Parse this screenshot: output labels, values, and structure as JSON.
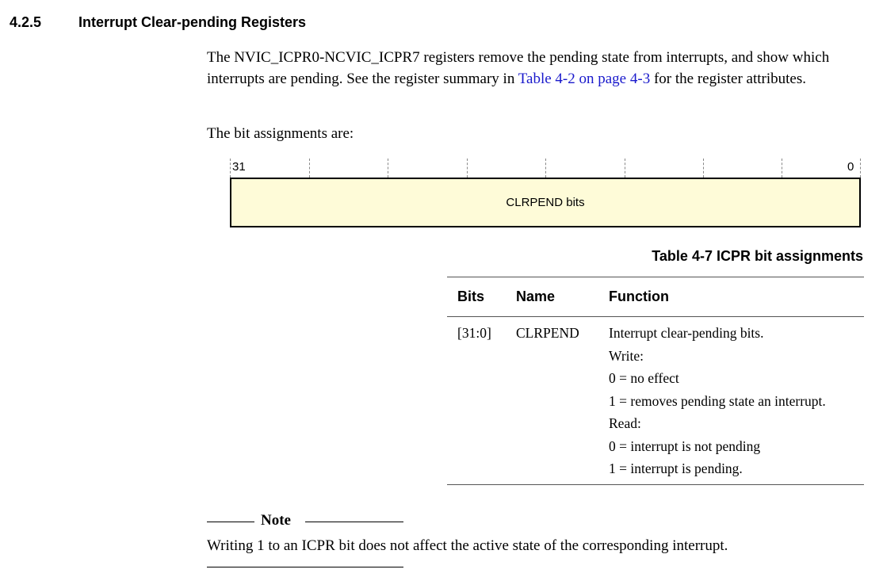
{
  "section": {
    "number": "4.2.5",
    "title": "Interrupt Clear-pending Registers"
  },
  "intro": {
    "text_before_link": "The NVIC_ICPR0-NCVIC_ICPR7 registers remove the pending state from interrupts, and show which interrupts are pending. See the register summary in ",
    "link": "Table 4-2 on page 4-3",
    "text_after_link": " for the register attributes."
  },
  "bit_assignments_intro": "The bit assignments are:",
  "register_diagram": {
    "msb_label": "31",
    "lsb_label": "0",
    "field_label": "CLRPEND bits",
    "field_color": "#fefbd8"
  },
  "table": {
    "caption": "Table 4-7 ICPR bit assignments",
    "headers": [
      "Bits",
      "Name",
      "Function"
    ],
    "rows": [
      {
        "bits": "[31:0]",
        "name": "CLRPEND",
        "function": [
          "Interrupt clear-pending bits.",
          "Write:",
          "0 = no effect",
          "1 = removes pending state an interrupt.",
          "Read:",
          "0 = interrupt is not pending",
          "1 = interrupt is pending."
        ]
      }
    ]
  },
  "note": {
    "label": "Note",
    "text": "Writing 1 to an ICPR bit does not affect the active state of the corresponding interrupt."
  }
}
